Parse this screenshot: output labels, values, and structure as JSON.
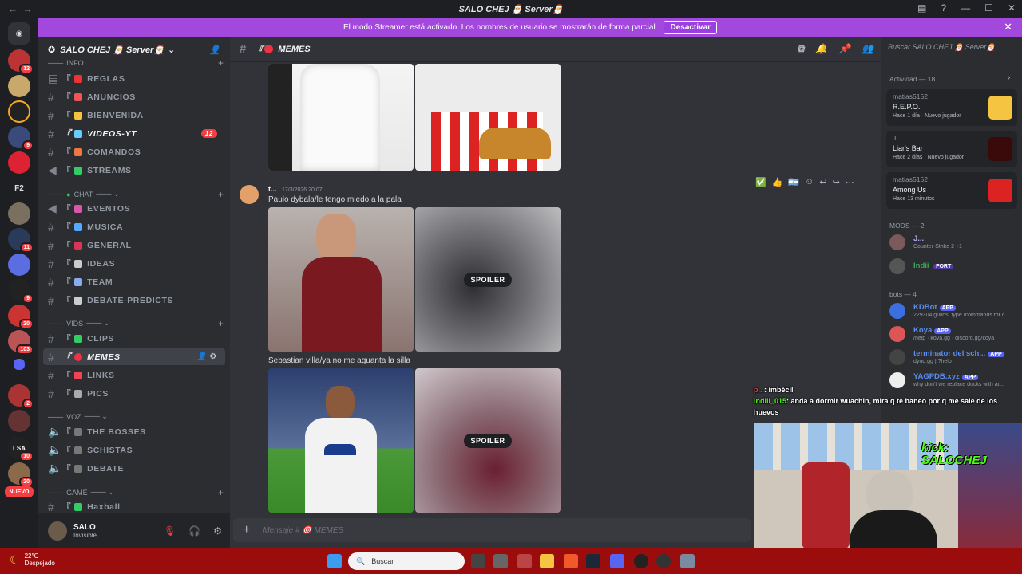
{
  "window": {
    "title": "SALO CHEJ 🎅 Server🎅",
    "controls": [
      "inbox",
      "help",
      "minimize",
      "maximize",
      "close"
    ]
  },
  "banner": {
    "text": "El modo Streamer está activado. Los nombres de usuario se mostrarán de forma parcial.",
    "button": "Desactivar"
  },
  "server": {
    "name": "SALO CHEJ 🎅 Server🎅",
    "rail_badges": [
      "12",
      "9",
      "11",
      "9",
      "20",
      "103",
      "2",
      "10",
      "20"
    ],
    "rail_labels": [
      "F2",
      "NUEVO"
    ]
  },
  "categories": {
    "info": "INFO",
    "chat": "CHAT",
    "vids": "VIDS",
    "voz": "VOZ",
    "game": "GAME"
  },
  "channels": {
    "reglas": "REGLAS",
    "anuncios": "ANUNCIOS",
    "bienvenida": "BIENVENIDA",
    "videos_yt": "VIDEOS-YT",
    "videos_yt_count": "12",
    "comandos": "COMANDOS",
    "streams": "STREAMS",
    "eventos": "EVENTOS",
    "musica": "MUSICA",
    "general": "GENERAL",
    "ideas": "IDEAS",
    "team": "TEAM",
    "debate_predicts": "DEBATE-PREDICTS",
    "clips": "CLIPS",
    "memes": "MEMES",
    "links": "LINKS",
    "pics": "PICS",
    "the_bosses": "THE BOSSES",
    "schistas": "SCHISTAS",
    "debate": "DEBATE",
    "haxball": "Haxball"
  },
  "user": {
    "name": "SALO",
    "status": "Invisible"
  },
  "chat": {
    "channel_name": "MEMES",
    "message": {
      "author": "t...",
      "timestamp": "17/3/2026 20:07",
      "text1": "Paulo dybala/le tengo miedo a la pala",
      "text2": "Sebastian villa/ya no me aguanta la silla",
      "spoiler1": "SPOILER",
      "spoiler2": "SPOILER"
    },
    "composer_placeholder": "Mensaje # 🎯 MEMES"
  },
  "members": {
    "search_placeholder": "Buscar SALO CHEJ 🎅 Server🎅",
    "activity_header": "Actividad — 18",
    "activities": [
      {
        "user": "matias5152",
        "game": "R.E.P.O.",
        "meta": "Hace 1 día",
        "tag": "Nuevo jugador"
      },
      {
        "user": "J...",
        "game": "Liar's Bar",
        "meta": "Hace 2 días",
        "tag": "Nuevo jugador"
      },
      {
        "user": "matias5152",
        "game": "Among Us",
        "meta": "Hace 13 minutos",
        "tag": ""
      }
    ],
    "mods_header": "MODS — 2",
    "mods": [
      {
        "name": "J...",
        "status": "Counter-Strike 2 +1"
      },
      {
        "name": "Indii",
        "status": "",
        "badge": "FORT"
      }
    ],
    "bots_header": "bots — 4",
    "bots": [
      {
        "name": "KDBot",
        "tag": "APP",
        "status": "229304 guilds; type /commands for c"
      },
      {
        "name": "Koya",
        "tag": "APP",
        "status": "/help · koya.gg · discord.gg/koya"
      },
      {
        "name": "terminator del sch...",
        "tag": "APP",
        "status": "dyno.gg | ?help"
      },
      {
        "name": "YAGPDB.xyz",
        "tag": "APP",
        "status": "why don't we replace ducks with ai..."
      }
    ]
  },
  "overlay": {
    "line1_user": "p...",
    "line1_text": ": imbécil",
    "line2_user": "Indiii_015",
    "line2_text": ": anda a dormir wuachin, mira q te baneo por q me sale de los huevos",
    "webcam_text": "kick: SALOCHEJ"
  },
  "taskbar": {
    "temp": "22°C",
    "weather": "Despejado",
    "search": "Buscar"
  },
  "colors": {
    "banner": "#a248dc",
    "accent": "#5865f2",
    "taskbar": "#9b0c0c",
    "badge": "#f23f43"
  }
}
